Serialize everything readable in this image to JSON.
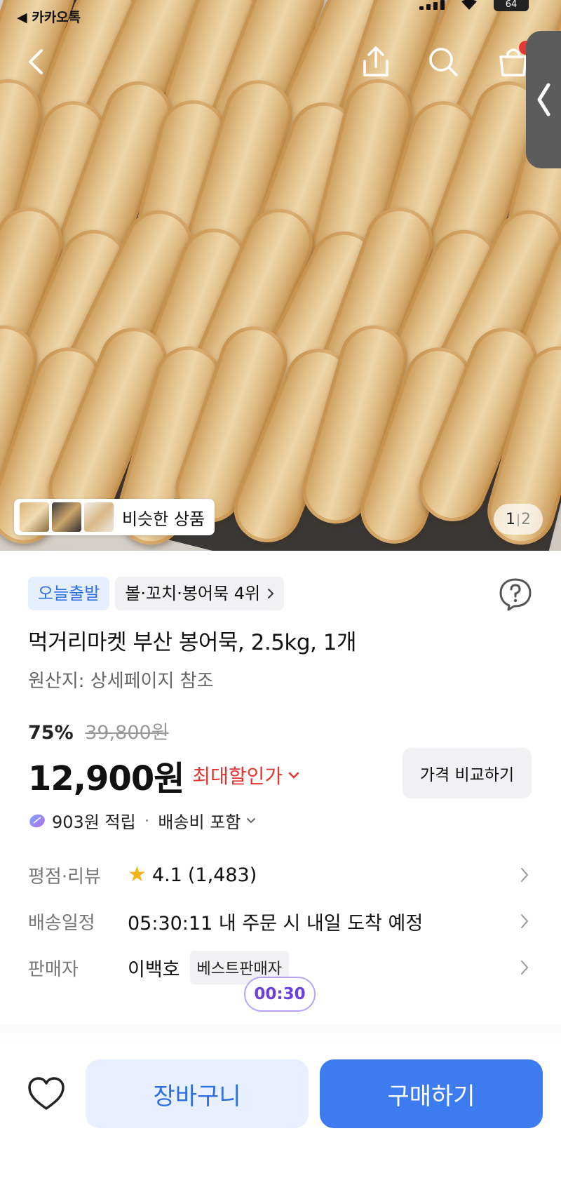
{
  "status_bar": {
    "back_app_label": "◀ 카카오톡",
    "battery": "64"
  },
  "hero": {
    "similar_label": "비슷한 상품",
    "pager_current": "1",
    "pager_total": "2"
  },
  "product": {
    "badge_today": "오늘출발",
    "badge_rank": "볼·꼬치·봉어묵 4위",
    "title": "먹거리마켓 부산 봉어묵, 2.5kg, 1개",
    "origin": "원산지: 상세페이지 참조",
    "discount_pct": "75%",
    "original_price": "39,800원",
    "price": "12,900원",
    "max_discount_label": "최대할인가",
    "compare_button": "가격 비교하기",
    "points_text": "903원 적립",
    "shipping_fee_text": "배송비 포함",
    "dot": "·"
  },
  "info": {
    "rating_label": "평점·리뷰",
    "rating_value": "4.1",
    "review_count": "(1,483)",
    "delivery_label": "배송일정",
    "delivery_value": "05:30:11 내 주문 시 내일 도착 예정",
    "seller_label": "판매자",
    "seller_name": "이백호",
    "seller_tag": "베스트판매자"
  },
  "timer": "00:30",
  "bottom": {
    "cart_button": "장바구니",
    "buy_button": "구매하기"
  },
  "colors": {
    "accent_blue": "#3d7cf0",
    "discount_red": "#e2352f",
    "badge_blue_bg": "#e6efff"
  }
}
